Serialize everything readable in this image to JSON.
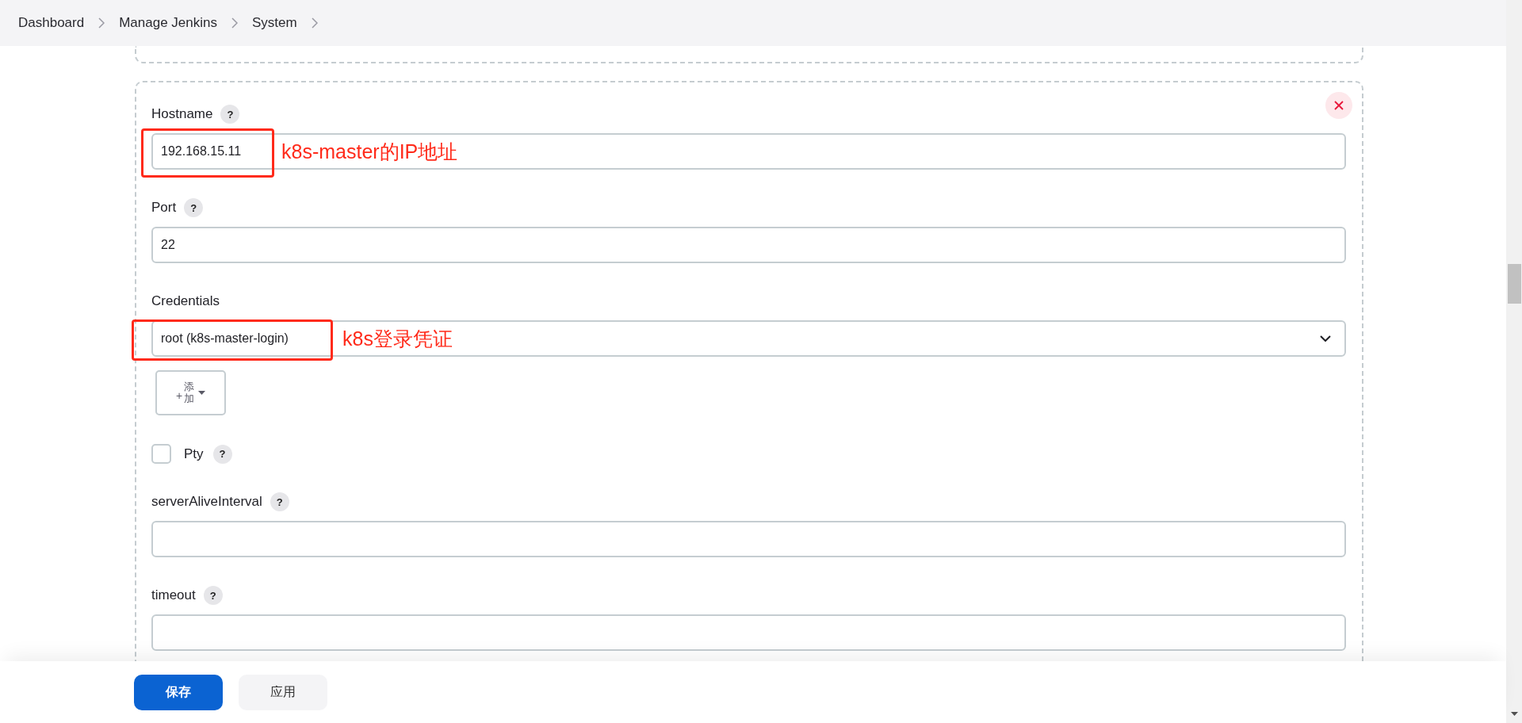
{
  "breadcrumbs": [
    {
      "label": "Dashboard"
    },
    {
      "label": "Manage Jenkins"
    },
    {
      "label": "System"
    }
  ],
  "form": {
    "fields": [
      {
        "kind": "text",
        "label": "Hostname",
        "help": "?",
        "value": "192.168.15.11",
        "annotation": "k8s-master的IP地址"
      },
      {
        "kind": "text",
        "label": "Port",
        "help": "?",
        "value": "22"
      },
      {
        "kind": "select",
        "label": "Credentials",
        "value": "root (k8s-master-login)",
        "annotation": "k8s登录凭证",
        "add_button": {
          "plus": "+",
          "label": "添加"
        }
      },
      {
        "kind": "checkbox",
        "label": "Pty",
        "help": "?",
        "checked": false
      },
      {
        "kind": "text",
        "label": "serverAliveInterval",
        "help": "?"
      },
      {
        "kind": "text",
        "label": "timeout",
        "help": "?"
      }
    ]
  },
  "footer": {
    "buttons": [
      {
        "kind": "primary",
        "label": "保存"
      },
      {
        "kind": "secondary",
        "label": "应用"
      }
    ]
  }
}
